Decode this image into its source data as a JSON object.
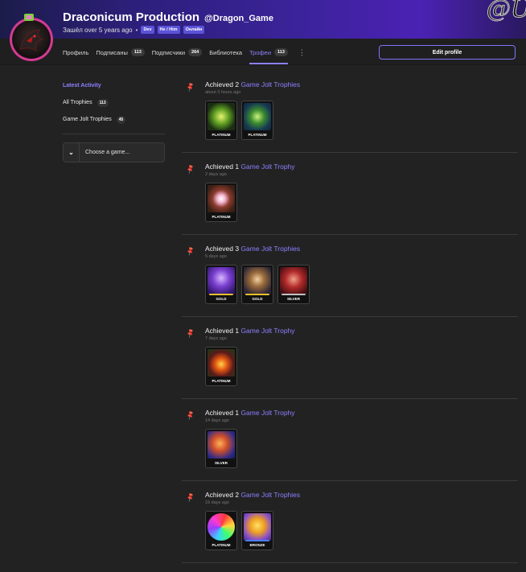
{
  "header": {
    "name": "Draconicum Production",
    "handle": "@Dragon_Game",
    "joined": "Зашёл over 5 years ago",
    "badges": [
      "Dev",
      "He / Him",
      "Онлайн"
    ],
    "edit_label": "Edit profile",
    "banner_deco_text": "@Ü"
  },
  "nav": {
    "tabs": [
      {
        "label": "Профиль",
        "count": null,
        "active": false
      },
      {
        "label": "Подписаны",
        "count": "113",
        "active": false
      },
      {
        "label": "Подписчики",
        "count": "264",
        "active": false
      },
      {
        "label": "Библиотека",
        "count": null,
        "active": false
      },
      {
        "label": "Трофеи",
        "count": "113",
        "active": true
      }
    ],
    "more_icon": "⋮"
  },
  "sidebar": {
    "heading": "Latest Activity",
    "links": [
      {
        "label": "All Trophies",
        "count": "113"
      },
      {
        "label": "Game Jolt Trophies",
        "count": "45"
      }
    ],
    "game_select": "Choose a game..."
  },
  "feed": [
    {
      "prefix": "Achieved 2",
      "link": "Game Jolt Trophies",
      "time": "about 3 hours ago",
      "trophies": [
        {
          "label": "PLATINUM",
          "art": "t1"
        },
        {
          "label": "PLATINUM",
          "art": "t2"
        }
      ]
    },
    {
      "prefix": "Achieved 1",
      "link": "Game Jolt Trophy",
      "time": "2 days ago",
      "trophies": [
        {
          "label": "PLATINUM",
          "art": "t3"
        }
      ]
    },
    {
      "prefix": "Achieved 3",
      "link": "Game Jolt Trophies",
      "time": "5 days ago",
      "trophies": [
        {
          "label": "GOLD",
          "art": "t4",
          "bar": "#e6c02a"
        },
        {
          "label": "GOLD",
          "art": "t5",
          "bar": "#e6c02a"
        },
        {
          "label": "SILVER",
          "art": "t6",
          "bar": "#c0c0c0"
        }
      ]
    },
    {
      "prefix": "Achieved 1",
      "link": "Game Jolt Trophy",
      "time": "7 days ago",
      "trophies": [
        {
          "label": "PLATINUM",
          "art": "t7"
        }
      ]
    },
    {
      "prefix": "Achieved 1",
      "link": "Game Jolt Trophy",
      "time": "14 days ago",
      "trophies": [
        {
          "label": "SILVER",
          "art": "t8"
        }
      ]
    },
    {
      "prefix": "Achieved 2",
      "link": "Game Jolt Trophies",
      "time": "19 days ago",
      "trophies": [
        {
          "label": "PLATINUM",
          "art": "t9"
        },
        {
          "label": "BRONZE",
          "art": "t10",
          "bar": "#4a7dff"
        }
      ]
    }
  ],
  "colors": {
    "accent": "#8c80ff",
    "badge": "#5b53d8",
    "avatar_ring": "#d43a92"
  }
}
